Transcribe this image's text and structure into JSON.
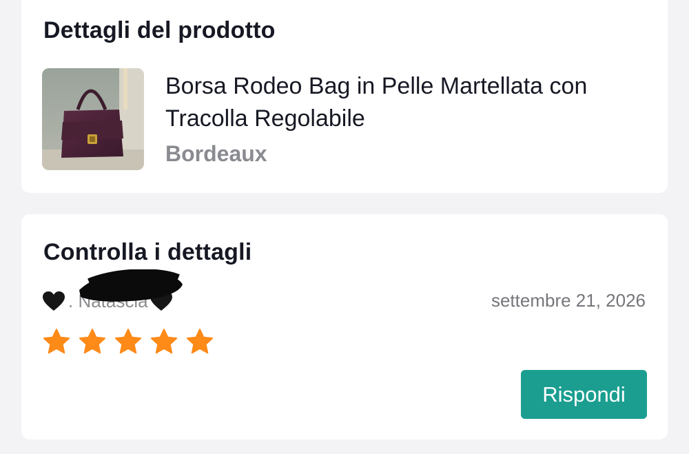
{
  "product_section": {
    "title": "Dettagli del prodotto",
    "product_name": "Borsa Rodeo Bag in Pelle Martellata con Tracolla Regolabile",
    "variant": "Bordeaux",
    "thumbnail_icon": "bag-photo"
  },
  "review_section": {
    "title": "Controlla i dettagli",
    "reviewer_name": ". Natascia",
    "reviewer_prefix_icon": "black-heart-icon",
    "date": "settembre 21, 2026",
    "rating": 5,
    "rating_max": 5,
    "reply_label": "Rispondi"
  },
  "colors": {
    "accent": "#1b9e90",
    "star": "#fe8a18",
    "variant_text": "#8a8b91",
    "date_text": "#75767b",
    "background": "#f3f3f5"
  }
}
